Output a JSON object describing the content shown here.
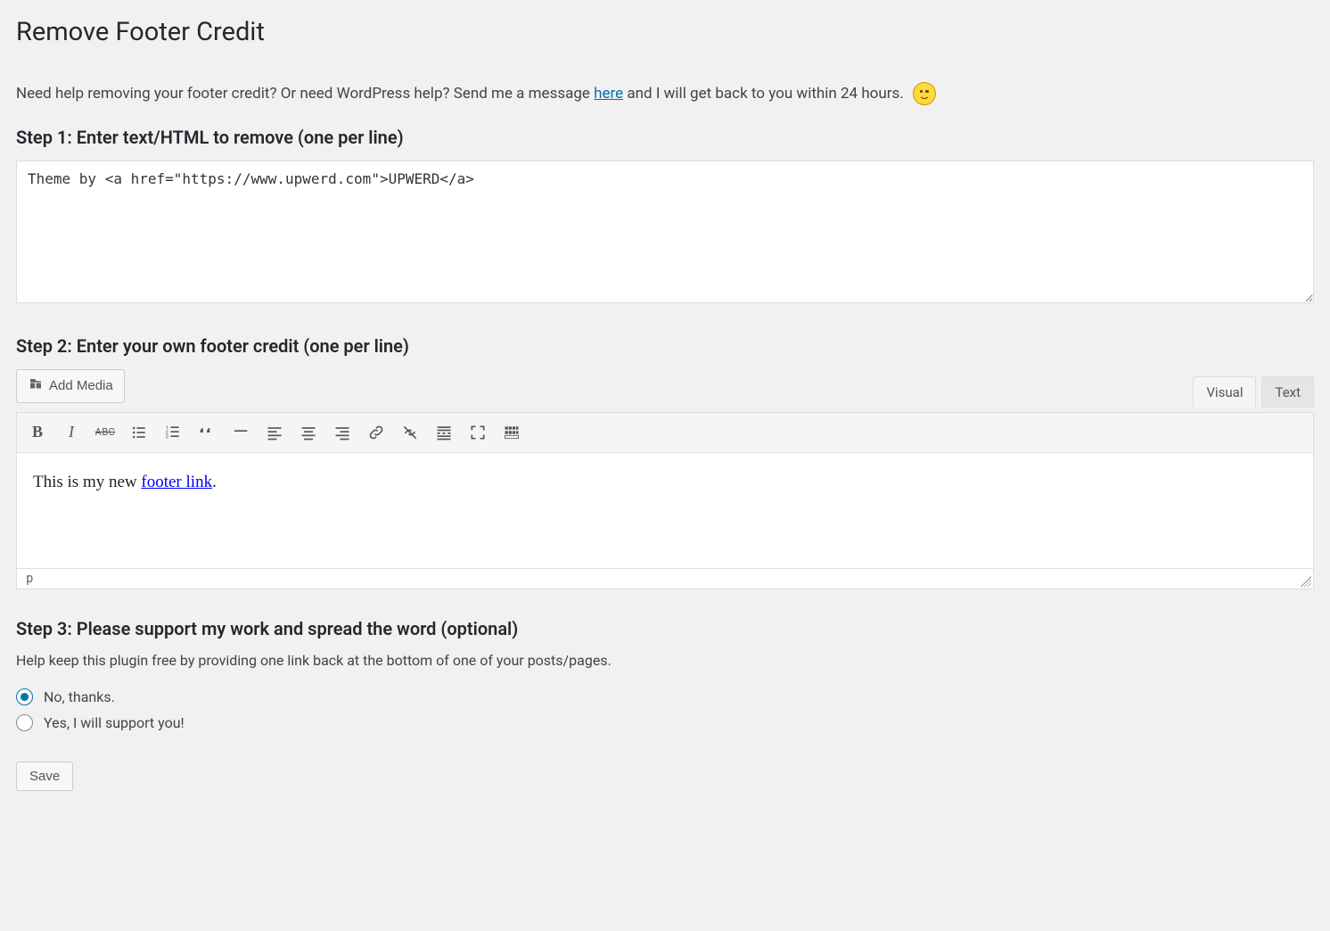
{
  "page_title": "Remove Footer Credit",
  "intro": {
    "prefix": "Need help removing your footer credit? Or need WordPress help? Send me a message ",
    "link_text": "here",
    "suffix": " and I will get back to you within 24 hours."
  },
  "step1": {
    "heading": "Step 1: Enter text/HTML to remove (one per line)",
    "value": "Theme by <a href=\"https://www.upwerd.com\">UPWERD</a>"
  },
  "step2": {
    "heading": "Step 2: Enter your own footer credit (one per line)",
    "add_media_label": "Add Media",
    "tabs": {
      "visual": "Visual",
      "text": "Text",
      "active": "visual"
    },
    "body_prefix": "This is my new ",
    "body_link": "footer link",
    "body_suffix": ".",
    "status_path": "p"
  },
  "step3": {
    "heading": "Step 3: Please support my work and spread the word (optional)",
    "help": "Help keep this plugin free by providing one link back at the bottom of one of your posts/pages.",
    "options": {
      "no": "No, thanks.",
      "yes": "Yes, I will support you!"
    },
    "selected": "no"
  },
  "save_label": "Save"
}
